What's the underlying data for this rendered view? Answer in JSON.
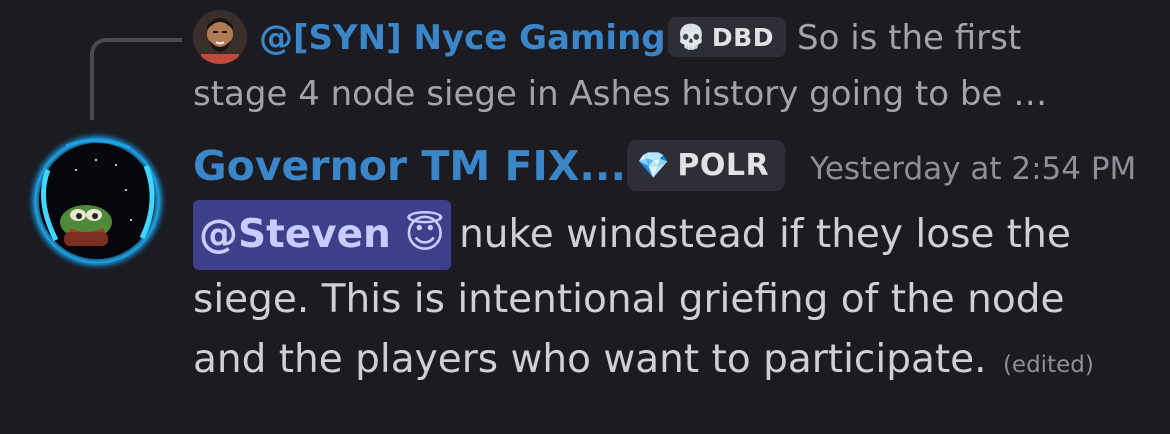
{
  "reply": {
    "author": "@[SYN] Nyce Gaming",
    "tag": "DBD",
    "tag_icon": "skull-icon",
    "text_line1": "So is the first",
    "text_line2": "stage 4 node siege in Ashes history going to be …"
  },
  "message": {
    "author": "Governor TM FIX...",
    "tag": "POLR",
    "tag_icon": "gem-icon",
    "timestamp": "Yesterday at 2:54 PM",
    "mention": "@Steven",
    "mention_emoji": "😇",
    "line1": "nuke windstead if they lose the",
    "line2": "siege. This is intentional griefing of the node",
    "line3": "and the players who want to participate.",
    "edited": "(edited)"
  },
  "colors": {
    "background": "#1b1b21",
    "username": "#3a86c8",
    "mention_bg": "#3d3f8b",
    "tag_bg": "#2e2f36"
  }
}
